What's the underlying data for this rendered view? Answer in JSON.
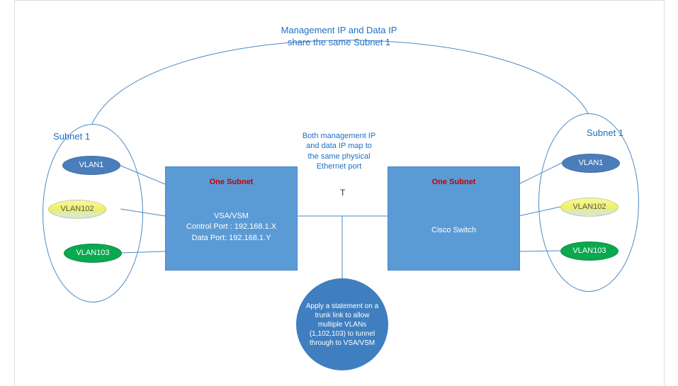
{
  "title": {
    "line1": "Management IP and Data IP",
    "line2": "share the same Subnet 1"
  },
  "midtext": {
    "line1": "Both management IP",
    "line2": "and data IP map to",
    "line3": "the same physical",
    "line4": "Ethernet port"
  },
  "left_box": {
    "head": "One Subnet",
    "line1": "VSA/VSM",
    "line2": "Control Port : 192.168.1.X",
    "line3": "Data Port: 192.168.1.Y"
  },
  "right_box": {
    "head": "One Subnet",
    "line1": "Cisco Switch"
  },
  "left_subnet_label": "Subnet 1",
  "right_subnet_label": "Subnet 1",
  "left_vlans": {
    "v1": "VLAN1",
    "v2": "VLAN102",
    "v3": "VLAN103"
  },
  "right_vlans": {
    "v1": "VLAN1",
    "v2": "VLAN102",
    "v3": "VLAN103"
  },
  "t_label": "T",
  "circle_note": "Apply a statement on a trunk link to allow multiple VLANs (1,102,103) to tunnel through to VSA/VSM"
}
